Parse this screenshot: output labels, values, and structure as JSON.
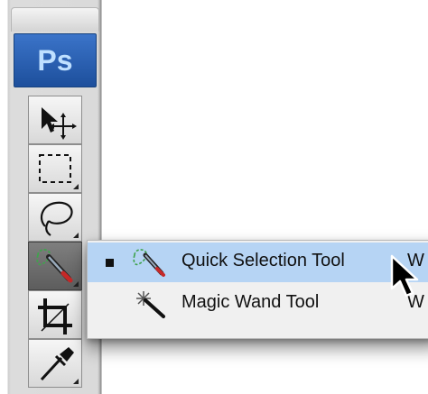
{
  "toolbox": {
    "logo_text": "Ps",
    "tools": [
      {
        "name": "move-tool"
      },
      {
        "name": "rectangular-marquee-tool"
      },
      {
        "name": "lasso-tool"
      },
      {
        "name": "quick-selection-tool",
        "active": true
      },
      {
        "name": "crop-tool"
      },
      {
        "name": "eyedropper-tool"
      }
    ]
  },
  "flyout_menu": {
    "items": [
      {
        "label": "Quick Selection Tool",
        "shortcut": "W",
        "selected": true,
        "highlighted": true,
        "icon": "quick-selection-icon"
      },
      {
        "label": "Magic Wand Tool",
        "shortcut": "W",
        "selected": false,
        "highlighted": false,
        "icon": "magic-wand-icon"
      }
    ]
  },
  "colors": {
    "ps_logo_bg": "#2a5fb3",
    "ps_logo_text": "#bfe0ff",
    "menu_highlight": "#b6d4f4",
    "active_tool_bg": "#6e6e6e"
  }
}
